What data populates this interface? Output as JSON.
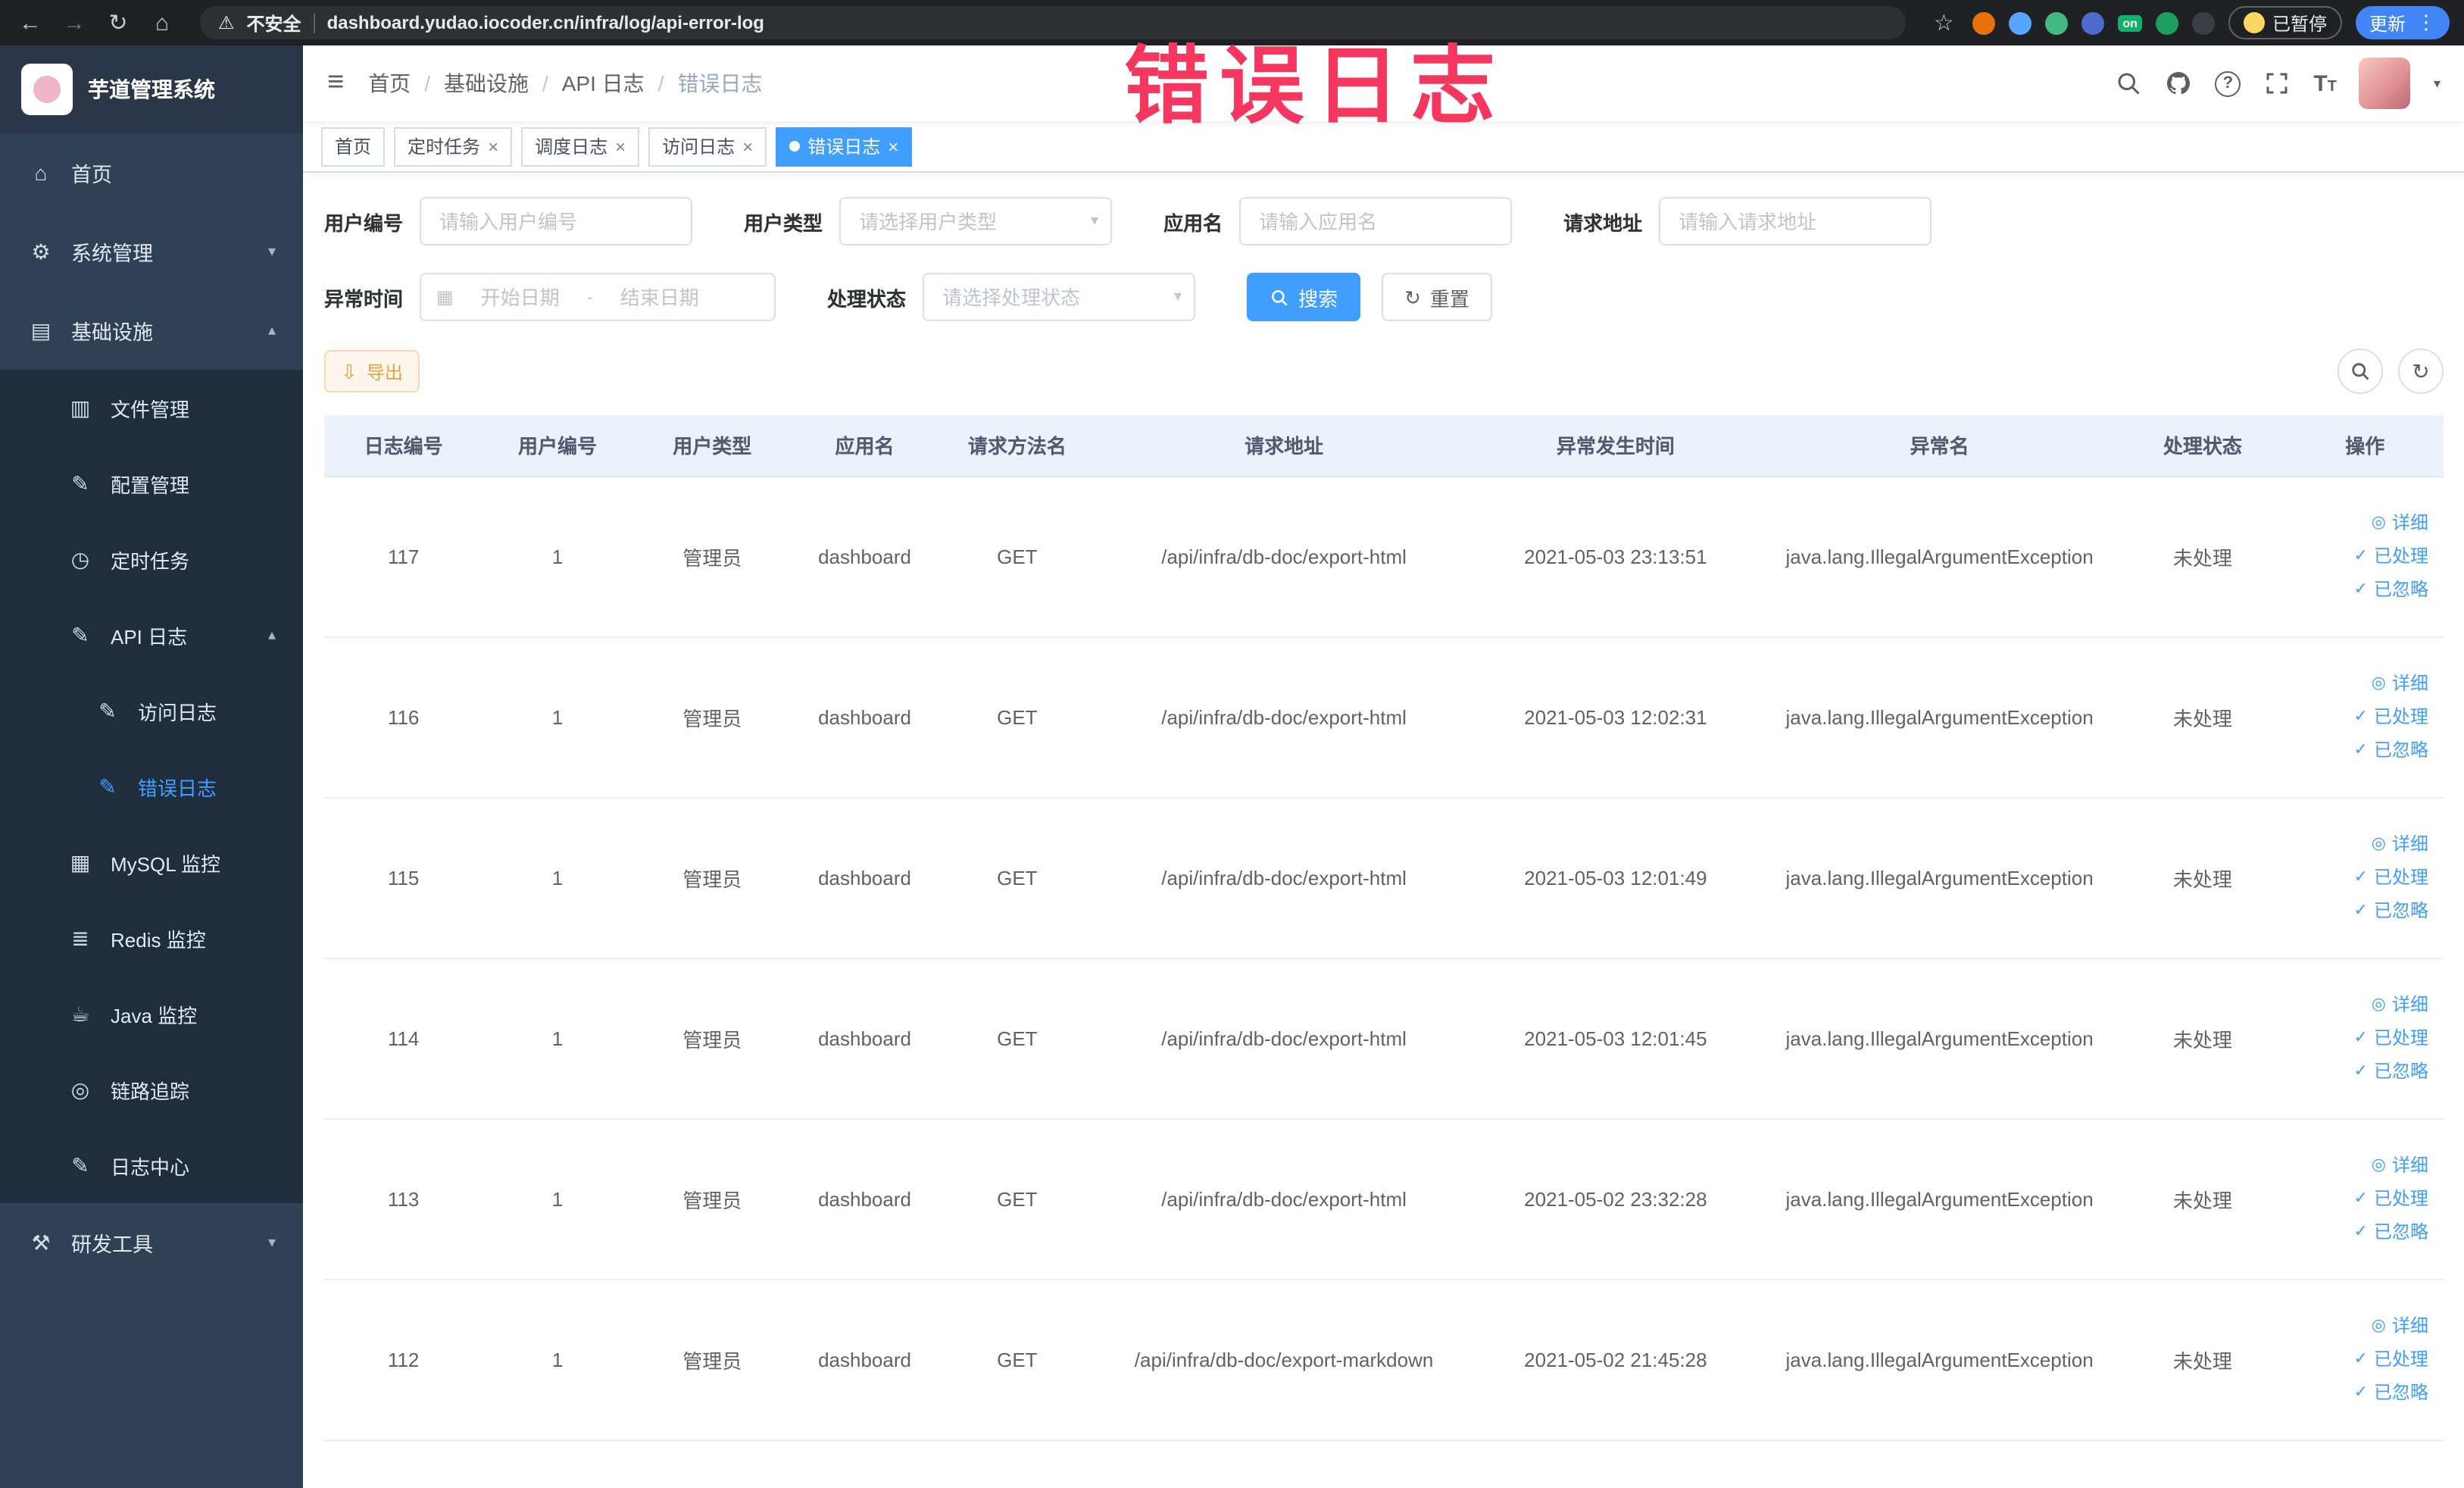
{
  "browser": {
    "security_label": "不安全",
    "url": "dashboard.yudao.iocoder.cn/infra/log/api-error-log",
    "extension_on_badge": "on",
    "paused_badge": "已暂停",
    "update_label": "更新"
  },
  "annotation": {
    "text": "错误日志"
  },
  "sidebar": {
    "logo_title": "芋道管理系统",
    "menu": [
      {
        "label": "首页"
      },
      {
        "label": "系统管理"
      },
      {
        "label": "基础设施"
      },
      {
        "label": "文件管理"
      },
      {
        "label": "配置管理"
      },
      {
        "label": "定时任务"
      },
      {
        "label": "API 日志"
      },
      {
        "label": "访问日志"
      },
      {
        "label": "错误日志"
      },
      {
        "label": "MySQL 监控"
      },
      {
        "label": "Redis 监控"
      },
      {
        "label": "Java 监控"
      },
      {
        "label": "链路追踪"
      },
      {
        "label": "日志中心"
      },
      {
        "label": "研发工具"
      }
    ]
  },
  "header": {
    "breadcrumb": [
      "首页",
      "基础设施",
      "API 日志",
      "错误日志"
    ],
    "breadcrumb_separator": "/"
  },
  "tabs": [
    {
      "label": "首页"
    },
    {
      "label": "定时任务"
    },
    {
      "label": "调度日志"
    },
    {
      "label": "访问日志"
    },
    {
      "label": "错误日志"
    }
  ],
  "filters": {
    "user_id": {
      "label": "用户编号",
      "placeholder": "请输入用户编号"
    },
    "user_type": {
      "label": "用户类型",
      "placeholder": "请选择用户类型"
    },
    "app_name": {
      "label": "应用名",
      "placeholder": "请输入应用名"
    },
    "request_url": {
      "label": "请求地址",
      "placeholder": "请输入请求地址"
    },
    "exception_time": {
      "label": "异常时间",
      "start_placeholder": "开始日期",
      "separator": "-",
      "end_placeholder": "结束日期"
    },
    "process_status": {
      "label": "处理状态",
      "placeholder": "请选择处理状态"
    },
    "search_label": "搜索",
    "reset_label": "重置"
  },
  "toolbar": {
    "export_label": "导出"
  },
  "table": {
    "columns": [
      "日志编号",
      "用户编号",
      "用户类型",
      "应用名",
      "请求方法名",
      "请求地址",
      "异常发生时间",
      "异常名",
      "处理状态",
      "操作"
    ],
    "actions": {
      "detail": "详细",
      "processed": "已处理",
      "ignored": "已忽略"
    },
    "rows": [
      {
        "id": "117",
        "user_id": "1",
        "user_type": "管理员",
        "app_name": "dashboard",
        "method": "GET",
        "url": "/api/infra/db-doc/export-html",
        "time": "2021-05-03 23:13:51",
        "exception": "java.lang.IllegalArgumentException",
        "status": "未处理"
      },
      {
        "id": "116",
        "user_id": "1",
        "user_type": "管理员",
        "app_name": "dashboard",
        "method": "GET",
        "url": "/api/infra/db-doc/export-html",
        "time": "2021-05-03 12:02:31",
        "exception": "java.lang.IllegalArgumentException",
        "status": "未处理"
      },
      {
        "id": "115",
        "user_id": "1",
        "user_type": "管理员",
        "app_name": "dashboard",
        "method": "GET",
        "url": "/api/infra/db-doc/export-html",
        "time": "2021-05-03 12:01:49",
        "exception": "java.lang.IllegalArgumentException",
        "status": "未处理"
      },
      {
        "id": "114",
        "user_id": "1",
        "user_type": "管理员",
        "app_name": "dashboard",
        "method": "GET",
        "url": "/api/infra/db-doc/export-html",
        "time": "2021-05-03 12:01:45",
        "exception": "java.lang.IllegalArgumentException",
        "status": "未处理"
      },
      {
        "id": "113",
        "user_id": "1",
        "user_type": "管理员",
        "app_name": "dashboard",
        "method": "GET",
        "url": "/api/infra/db-doc/export-html",
        "time": "2021-05-02 23:32:28",
        "exception": "java.lang.IllegalArgumentException",
        "status": "未处理"
      },
      {
        "id": "112",
        "user_id": "1",
        "user_type": "管理员",
        "app_name": "dashboard",
        "method": "GET",
        "url": "/api/infra/db-doc/export-markdown",
        "time": "2021-05-02 21:45:28",
        "exception": "java.lang.IllegalArgumentException",
        "status": "未处理"
      }
    ]
  },
  "colors": {
    "accent": "#409EFF",
    "warning": "#E6A23C",
    "annotation": "#F5365F",
    "sidebar": "#304156"
  }
}
